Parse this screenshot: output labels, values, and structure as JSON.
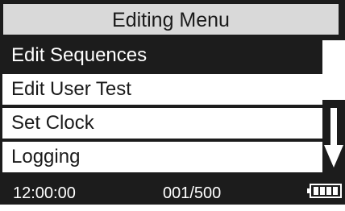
{
  "title": "Editing Menu",
  "menu": {
    "items": [
      {
        "label": "Edit Sequences",
        "selected": true
      },
      {
        "label": "Edit User Test",
        "selected": false
      },
      {
        "label": "Set Clock",
        "selected": false
      },
      {
        "label": "Logging",
        "selected": false
      }
    ]
  },
  "status": {
    "time": "12:00:00",
    "count": "001/500",
    "battery_icon": "battery-icon",
    "battery_level": 1.0
  },
  "scroll": {
    "icon": "arrow-down-icon"
  },
  "colors": {
    "background": "#1c1c1c",
    "title_bg": "#d9d9d9",
    "text_dark": "#1a1a1a",
    "text_light": "#ffffff"
  }
}
